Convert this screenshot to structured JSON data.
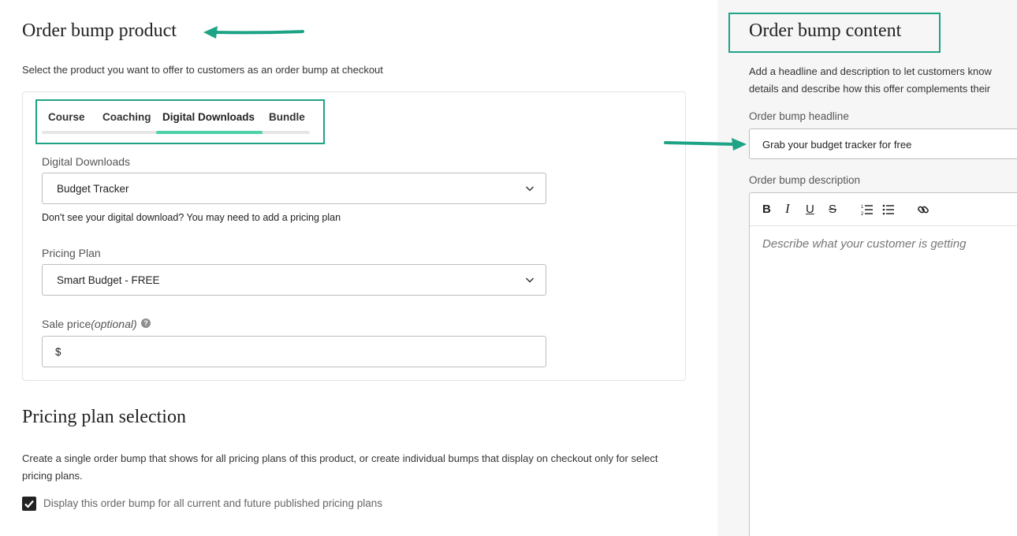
{
  "left": {
    "title": "Order bump product",
    "subtitle": "Select the product you want to offer to customers as an order bump at checkout",
    "tabs": [
      {
        "label": "Course",
        "active": false
      },
      {
        "label": "Coaching",
        "active": false
      },
      {
        "label": "Digital Downloads",
        "active": true
      },
      {
        "label": "Bundle",
        "active": false
      }
    ],
    "downloads_label": "Digital Downloads",
    "downloads_value": "Budget Tracker",
    "downloads_hint": "Don't see your digital download? You may need to add a pricing plan",
    "pricing_label": "Pricing Plan",
    "pricing_value": "Smart Budget - FREE",
    "sale_label": "Sale price",
    "sale_optional": "(optional)",
    "sale_currency": "$",
    "help_icon": "?",
    "plan_title": "Pricing plan selection",
    "plan_desc": "Create a single order bump that shows for all pricing plans of this product, or create individual bumps that display on checkout only for select pricing plans.",
    "checkbox_label": "Display this order bump for all current and future published pricing plans",
    "checkbox_checked": true
  },
  "right": {
    "title": "Order bump content",
    "desc_line1": "Add a headline and description to let customers know",
    "desc_line2": "details and describe how this offer complements their",
    "headline_label": "Order bump headline",
    "headline_value": "Grab your budget tracker for free",
    "description_label": "Order bump description",
    "toolbar": {
      "bold": "B",
      "italic": "I",
      "underline": "U",
      "strike": "S"
    },
    "description_placeholder": "Describe what your customer is getting"
  },
  "icons": [
    "chevron-down-icon",
    "help-icon",
    "checkmark-icon",
    "ordered-list-icon",
    "bullet-list-icon",
    "link-icon",
    "annotation-arrow-icon"
  ],
  "colors": {
    "annotation": "#1fa386",
    "tab_ink": "#4fd1a8",
    "panel_bg": "#f6f6f6"
  }
}
